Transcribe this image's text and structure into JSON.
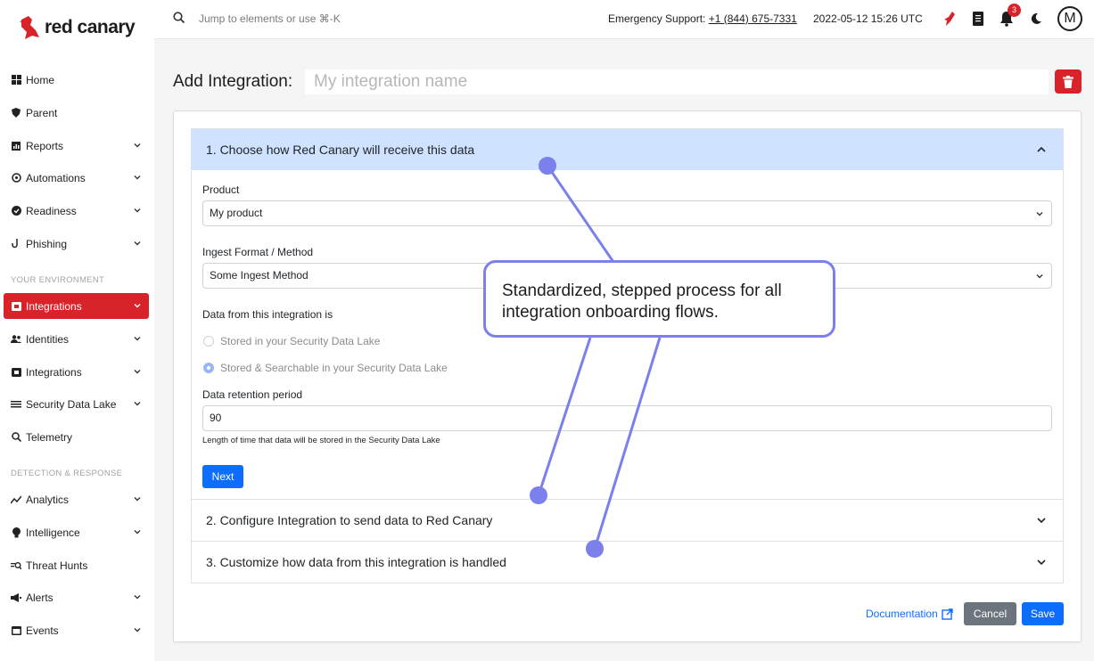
{
  "brand": {
    "name": "red canary",
    "accent": "#d8232a"
  },
  "topbar": {
    "search_placeholder": "Jump to elements or use ⌘-K",
    "emergency_label": "Emergency Support:",
    "emergency_phone": "+1 (844) 675-7331",
    "timestamp": "2022-05-12 15:26 UTC",
    "notification_count": "3",
    "avatar_initial": "M"
  },
  "sidebar": {
    "items": [
      {
        "label": "Home",
        "icon": "grid-icon"
      },
      {
        "label": "Parent",
        "icon": "shield-icon"
      },
      {
        "label": "Reports",
        "icon": "chart-icon"
      },
      {
        "label": "Automations",
        "icon": "automation-icon"
      },
      {
        "label": "Readiness",
        "icon": "check-circle-icon"
      },
      {
        "label": "Phishing",
        "icon": "hook-icon"
      }
    ],
    "section_environment": "YOUR ENVIRONMENT",
    "env_items": [
      {
        "label": "Integrations",
        "icon": "plug-icon",
        "active": true
      },
      {
        "label": "Identities",
        "icon": "users-icon"
      },
      {
        "label": "Integrations",
        "icon": "integration-icon"
      },
      {
        "label": "Security Data Lake",
        "icon": "lake-icon"
      },
      {
        "label": "Telemetry",
        "icon": "telemetry-icon"
      }
    ],
    "section_detection": "DETECTION & RESPONSE",
    "detect_items": [
      {
        "label": "Analytics",
        "icon": "analytics-icon"
      },
      {
        "label": "Intelligence",
        "icon": "bulb-icon"
      },
      {
        "label": "Threat Hunts",
        "icon": "hunt-icon"
      },
      {
        "label": "Alerts",
        "icon": "megaphone-icon"
      },
      {
        "label": "Events",
        "icon": "calendar-icon"
      }
    ]
  },
  "header": {
    "title": "Add Integration:",
    "name_placeholder": "My integration name"
  },
  "steps": [
    {
      "label": "1. Choose how Red Canary will receive this data",
      "expanded": true
    },
    {
      "label": "2. Configure Integration to send data to Red Canary",
      "expanded": false
    },
    {
      "label": "3. Customize how data from this integration is handled",
      "expanded": false
    }
  ],
  "form": {
    "product_label": "Product",
    "product_value": "My product",
    "ingest_label": "Ingest Format / Method",
    "ingest_value": "Some Ingest Method",
    "data_label": "Data from this integration is",
    "radio_stored": "Stored in your Security Data Lake",
    "radio_searchable": "Stored & Searchable in your Security Data Lake",
    "retention_label": "Data retention period",
    "retention_value": "90",
    "retention_help": "Length of time that data will be stored in the Security Data Lake",
    "next_label": "Next"
  },
  "footer": {
    "documentation": "Documentation",
    "cancel": "Cancel",
    "save": "Save"
  },
  "callout": {
    "text": "Standardized, stepped process for all integration onboarding flows.",
    "color": "#7b80ec"
  }
}
